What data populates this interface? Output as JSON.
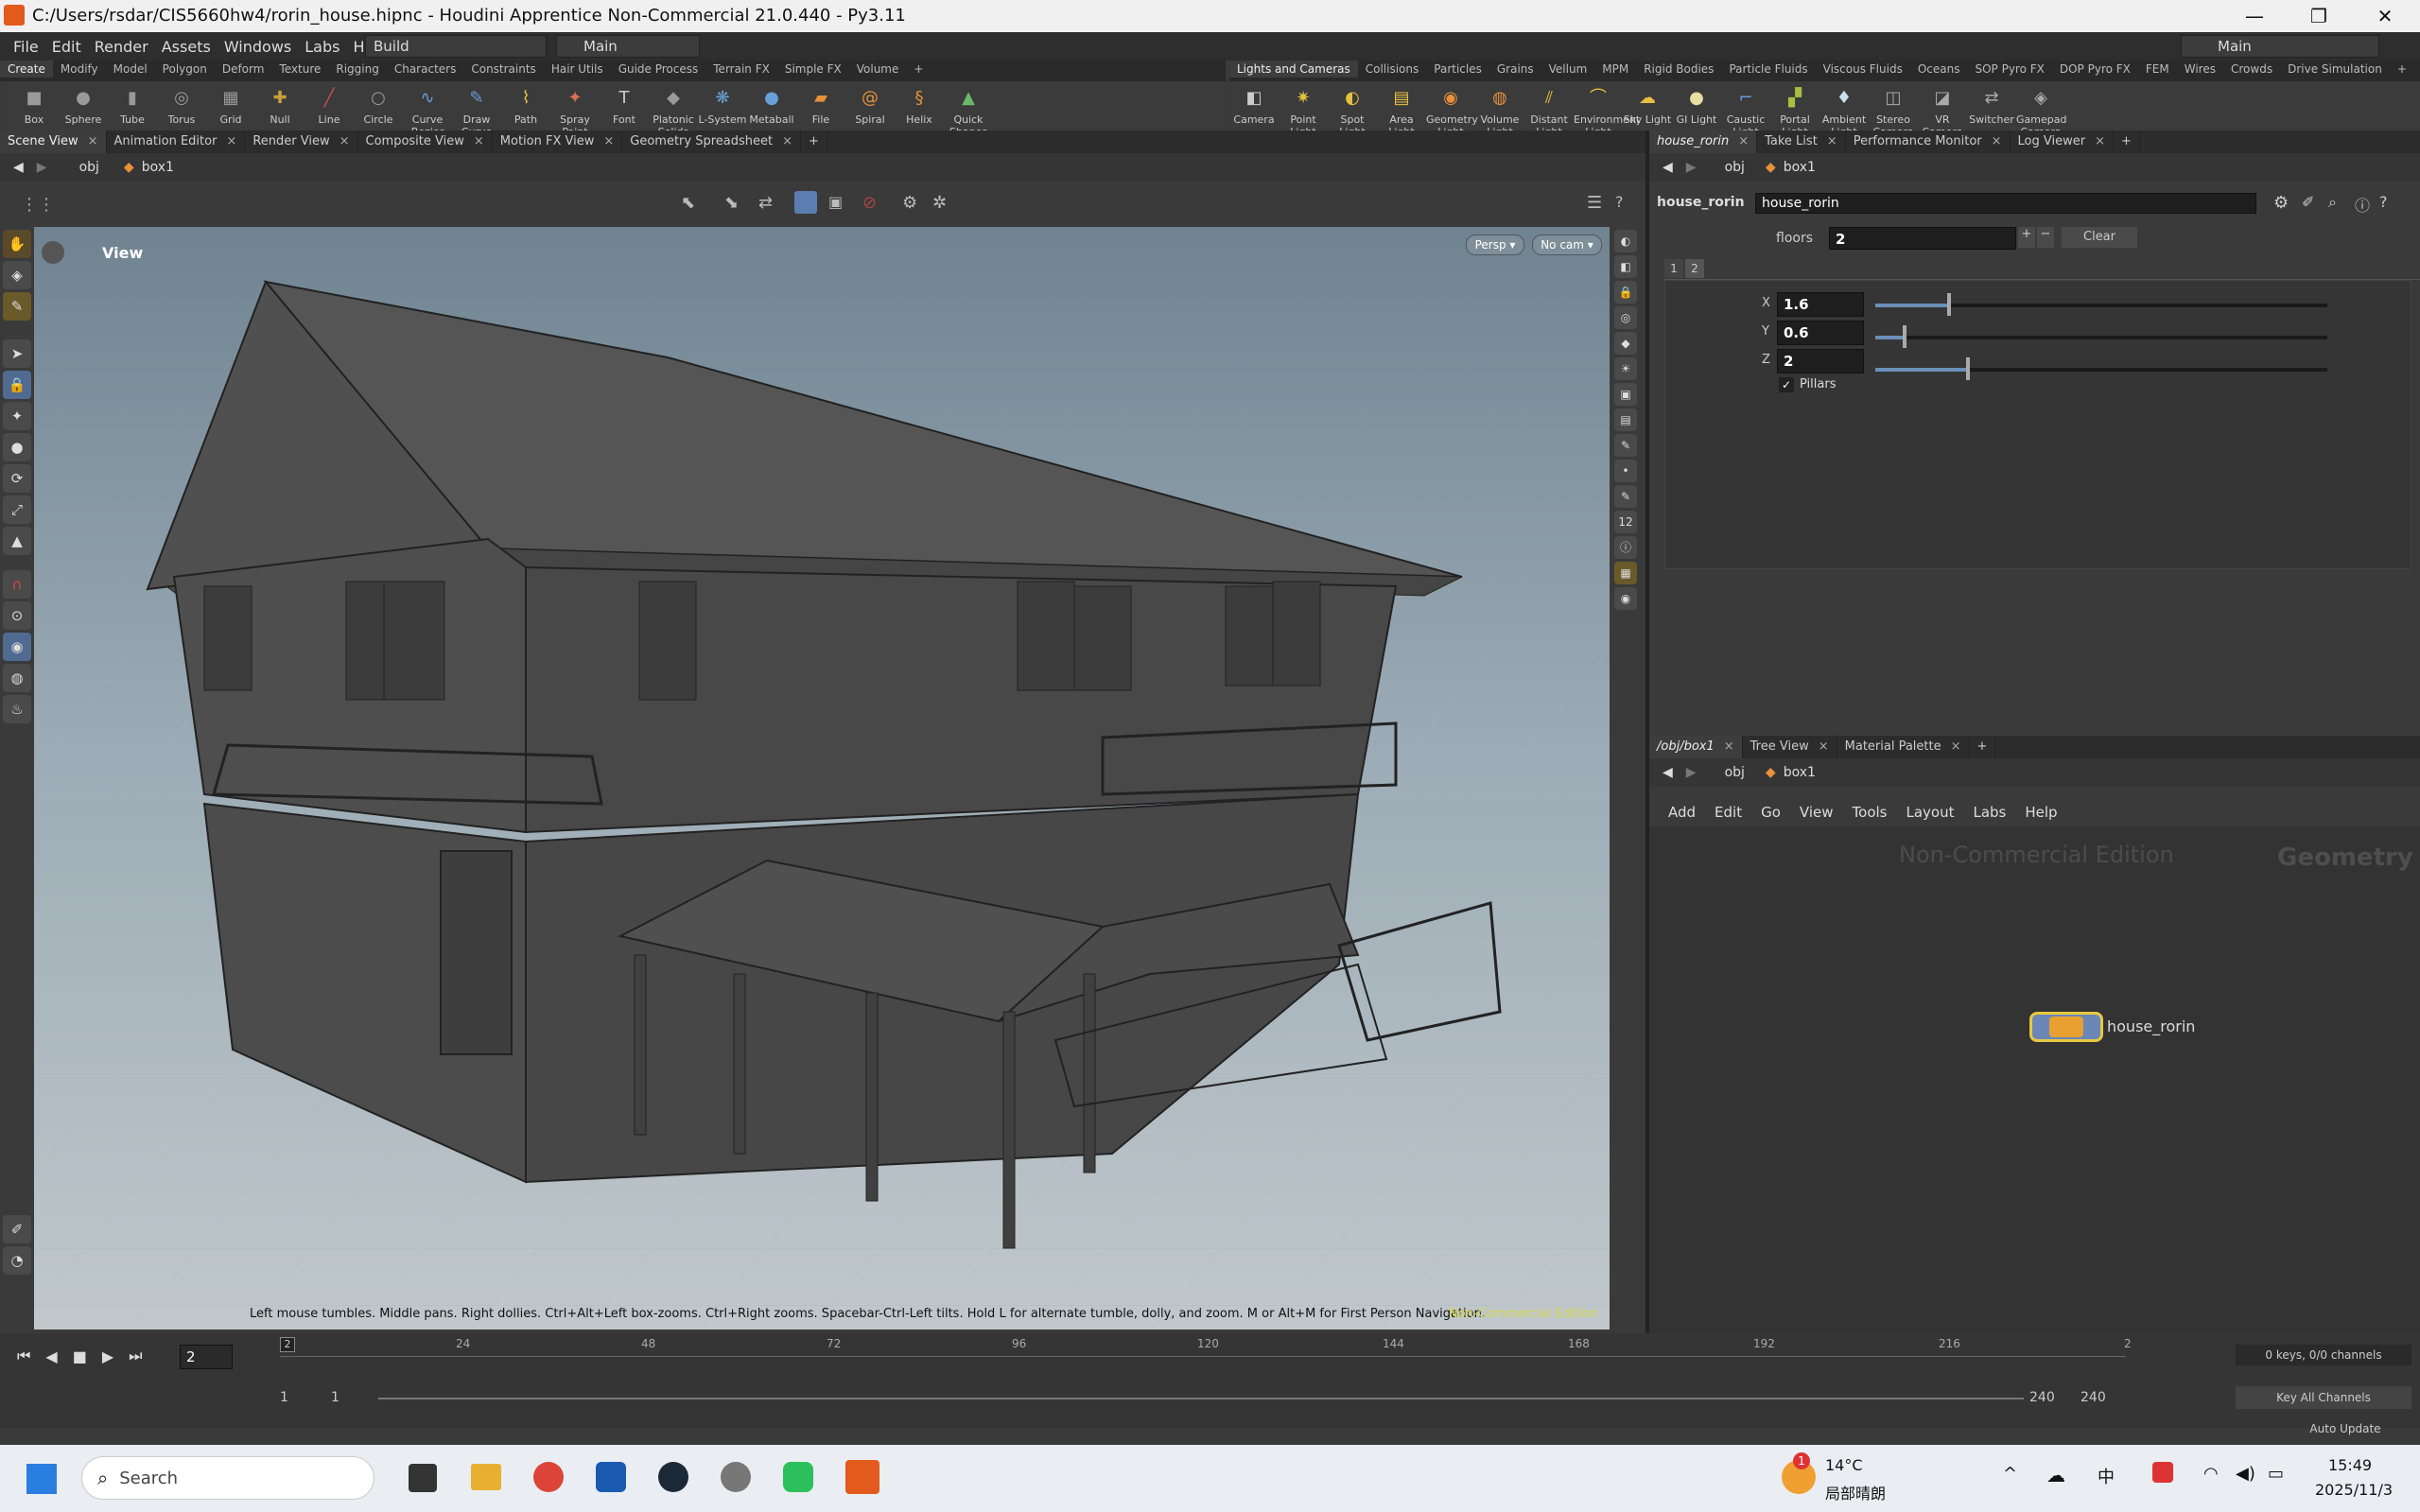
{
  "window": {
    "title": "C:/Users/rsdar/CIS5660hw4/rorin_house.hipnc - Houdini Apprentice Non-Commercial 21.0.440 - Py3.11",
    "minimize": "—",
    "maximize": "❐",
    "close": "✕"
  },
  "menu": [
    "File",
    "Edit",
    "Render",
    "Assets",
    "Windows",
    "Labs",
    "Help"
  ],
  "desktop_build": "Build",
  "desktop_main": "Main",
  "desktop_right": "Main",
  "shelf_tabs_left": [
    "Create",
    "Modify",
    "Model",
    "Polygon",
    "Deform",
    "Texture",
    "Rigging",
    "Characters",
    "Constraints",
    "Hair Utils",
    "Guide Process",
    "Terrain FX",
    "Simple FX",
    "Volume",
    "+"
  ],
  "shelf_tabs_right": [
    "Lights and Cameras",
    "Collisions",
    "Particles",
    "Grains",
    "Vellum",
    "MPM",
    "Rigid Bodies",
    "Particle Fluids",
    "Viscous Fluids",
    "Oceans",
    "SOP Pyro FX",
    "DOP Pyro FX",
    "FEM",
    "Wires",
    "Crowds",
    "Drive Simulation",
    "+"
  ],
  "tools_left": [
    {
      "label": "Box",
      "icon": "■",
      "color": "#9a9a9a"
    },
    {
      "label": "Sphere",
      "icon": "●",
      "color": "#9a9a9a"
    },
    {
      "label": "Tube",
      "icon": "▮",
      "color": "#9a9a9a"
    },
    {
      "label": "Torus",
      "icon": "◎",
      "color": "#9a9a9a"
    },
    {
      "label": "Grid",
      "icon": "▦",
      "color": "#9a9a9a"
    },
    {
      "label": "Null",
      "icon": "✚",
      "color": "#c8a040"
    },
    {
      "label": "Line",
      "icon": "╱",
      "color": "#c85050"
    },
    {
      "label": "Circle",
      "icon": "○",
      "color": "#9a9a9a"
    },
    {
      "label": "Curve Bezier",
      "icon": "∿",
      "color": "#6a9ad8"
    },
    {
      "label": "Draw Curve",
      "icon": "✎",
      "color": "#6a9ad8"
    },
    {
      "label": "Path",
      "icon": "⌇",
      "color": "#e8c040"
    },
    {
      "label": "Spray Paint",
      "icon": "✦",
      "color": "#d87050"
    },
    {
      "label": "Font",
      "icon": "T",
      "color": "#cccccc"
    },
    {
      "label": "Platonic Solids",
      "icon": "◆",
      "color": "#9a9a9a"
    },
    {
      "label": "L-System",
      "icon": "❋",
      "color": "#6aa0d8"
    },
    {
      "label": "Metaball",
      "icon": "●",
      "color": "#6aa0d8"
    },
    {
      "label": "File",
      "icon": "▰",
      "color": "#e8903a"
    },
    {
      "label": "Spiral",
      "icon": "@",
      "color": "#e8903a"
    },
    {
      "label": "Helix",
      "icon": "§",
      "color": "#e8903a"
    },
    {
      "label": "Quick Shapes",
      "icon": "▲",
      "color": "#6ab86a"
    }
  ],
  "tools_right": [
    {
      "label": "Camera",
      "icon": "◧",
      "color": "#cccccc"
    },
    {
      "label": "Point Light",
      "icon": "✷",
      "color": "#e8c040"
    },
    {
      "label": "Spot Light",
      "icon": "◐",
      "color": "#e8c040"
    },
    {
      "label": "Area Light",
      "icon": "▤",
      "color": "#e8c040"
    },
    {
      "label": "Geometry Light",
      "icon": "◉",
      "color": "#e8903a"
    },
    {
      "label": "Volume Light",
      "icon": "◍",
      "color": "#e8903a"
    },
    {
      "label": "Distant Light",
      "icon": "⫽",
      "color": "#e8c040"
    },
    {
      "label": "Environment Light",
      "icon": "⌒",
      "color": "#e8c040"
    },
    {
      "label": "Sky Light",
      "icon": "☁",
      "color": "#e8c040"
    },
    {
      "label": "GI Light",
      "icon": "●",
      "color": "#e8e0a0"
    },
    {
      "label": "Caustic Light",
      "icon": "⌐",
      "color": "#6a9ad8"
    },
    {
      "label": "Portal Light",
      "icon": "▞",
      "color": "#a8c040"
    },
    {
      "label": "Ambient Light",
      "icon": "♦",
      "color": "#c8e0f0"
    },
    {
      "label": "Stereo Camera",
      "icon": "◫",
      "color": "#aaaaaa"
    },
    {
      "label": "VR Camera",
      "icon": "◪",
      "color": "#aaaaaa"
    },
    {
      "label": "Switcher",
      "icon": "⇄",
      "color": "#aaaaaa"
    },
    {
      "label": "Gamepad Camera",
      "icon": "◈",
      "color": "#aaaaaa"
    }
  ],
  "left_tabs": [
    "Scene View",
    "Animation Editor",
    "Render View",
    "Composite View",
    "Motion FX View",
    "Geometry Spreadsheet"
  ],
  "right_top_tabs": [
    "house_rorin",
    "Take List",
    "Performance Monitor",
    "Log Viewer"
  ],
  "right_bottom_tabs": [
    "/obj/box1",
    "Tree View",
    "Material Palette"
  ],
  "path": {
    "obj": "obj",
    "node": "box1"
  },
  "viewport": {
    "label": "View",
    "persp": "Persp",
    "cam": "No cam",
    "status": "Left mouse tumbles. Middle pans. Right dollies. Ctrl+Alt+Left box-zooms. Ctrl+Right zooms. Spacebar-Ctrl-Left tilts. Hold L for alternate tumble, dolly, and zoom. M or Alt+M for First Person Navigation.",
    "watermark": "Non-Commercial Edition"
  },
  "params": {
    "type": "house_rorin",
    "name": "house_rorin",
    "floors_label": "floors",
    "floors": "2",
    "clear": "Clear",
    "multiparm_tabs": [
      "1",
      "2"
    ],
    "x_label": "X",
    "x": "1.6",
    "y_label": "Y",
    "y": "0.6",
    "z_label": "Z",
    "z": "2",
    "pillars": "Pillars",
    "x_level": 0.16,
    "y_level": 0.06,
    "z_level": 0.2
  },
  "network": {
    "menu": [
      "Add",
      "Edit",
      "Go",
      "View",
      "Tools",
      "Layout",
      "Labs",
      "Help"
    ],
    "watermark": "Non-Commercial Edition",
    "context": "Geometry",
    "node_label": "house_rorin"
  },
  "timeline": {
    "frame": "2",
    "ticks": [
      "24",
      "48",
      "72",
      "96",
      "120",
      "144",
      "168",
      "192",
      "216",
      "2"
    ],
    "start": "1",
    "start2": "1",
    "end": "240",
    "end2": "240",
    "keys": "0 keys, 0/0 channels",
    "key_all": "Key All Channels",
    "auto_update": "Auto Update"
  },
  "taskbar": {
    "search": "Search",
    "temp": "14°C",
    "weather": "局部晴朗",
    "time": "15:49",
    "date": "2025/11/3",
    "badge": "1",
    "ime": "中"
  }
}
